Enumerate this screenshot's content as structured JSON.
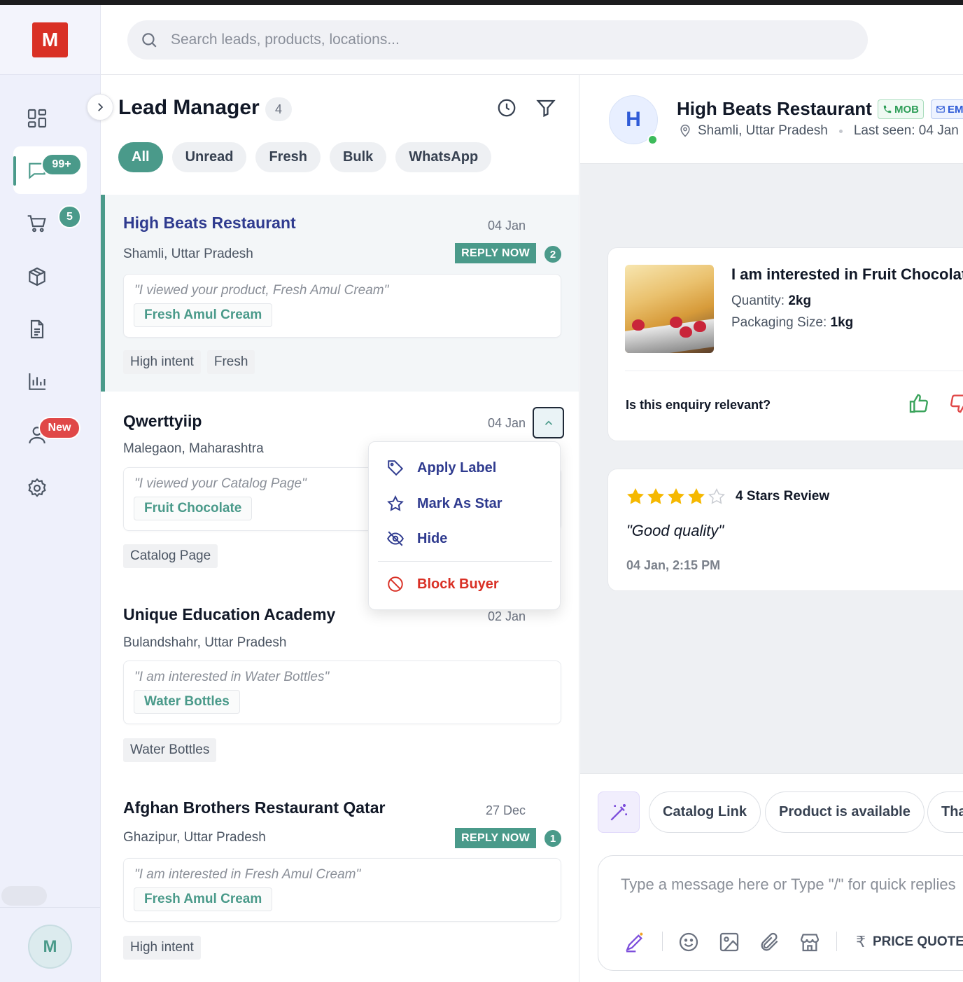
{
  "rail": {
    "logo": "M",
    "messages_badge": "99+",
    "cart_badge": "5",
    "contacts_badge": "New",
    "user_initial": "M"
  },
  "search": {
    "placeholder": "Search leads, products, locations..."
  },
  "leads_panel": {
    "title": "Lead Manager",
    "count": "4",
    "filters": [
      "All",
      "Unread",
      "Fresh",
      "Bulk",
      "WhatsApp"
    ],
    "active_filter": "All",
    "leads": [
      {
        "name": "High Beats Restaurant",
        "date": "04 Jan",
        "location": "Shamli, Uttar Pradesh",
        "reply_label": "REPLY NOW",
        "unread": "2",
        "quote": "\"I viewed your product, Fresh Amul Cream\"",
        "product": "Fresh Amul Cream",
        "labels": [
          "High intent",
          "Fresh"
        ]
      },
      {
        "name": "Qwerttyiip",
        "date": "04 Jan",
        "location": "Malegaon, Maharashtra",
        "quote": "\"I viewed your Catalog Page\"",
        "product": "Fruit Chocolate",
        "labels": [
          "Catalog Page"
        ]
      },
      {
        "name": "Unique Education Academy",
        "date": "02 Jan",
        "location": "Bulandshahr, Uttar Pradesh",
        "quote": "\"I am interested in Water Bottles\"",
        "product": "Water Bottles",
        "labels": [
          "Water Bottles"
        ]
      },
      {
        "name": "Afghan Brothers Restaurant Qatar",
        "date": "27 Dec",
        "location": "Ghazipur, Uttar Pradesh",
        "reply_label": "REPLY NOW",
        "unread": "1",
        "quote": "\"I am interested in Fresh Amul Cream\"",
        "product": "Fresh Amul Cream",
        "labels": [
          "High intent"
        ]
      }
    ]
  },
  "menu": {
    "items": [
      "Apply Label",
      "Mark As Star",
      "Hide",
      "Block Buyer"
    ]
  },
  "chat": {
    "avatar_initial": "H",
    "name": "High Beats Restaurant",
    "tag_mob": "MOB",
    "tag_email": "EM",
    "location": "Shamli, Uttar Pradesh",
    "last_seen": "Last seen: 04 Jan",
    "enquiry": {
      "title": "I am interested in Fruit Chocolate",
      "quantity_label": "Quantity:",
      "quantity": "2kg",
      "packaging_label": "Packaging Size:",
      "packaging": "1kg",
      "relevance_question": "Is this enquiry relevant?"
    },
    "review": {
      "rating": 4,
      "max_rating": 5,
      "label": "4 Stars Review",
      "text": "\"Good quality\"",
      "date": "04 Jan, 2:15 PM"
    },
    "quick_replies": [
      "Catalog Link",
      "Product is available",
      "Thank you"
    ],
    "message_placeholder": "Type a message here or Type \"/\" for quick replies",
    "price_quote": "PRICE QUOTE",
    "rupee": "₹"
  },
  "colors": {
    "accent": "#4a9a8a",
    "brand": "#d93025",
    "link": "#2f3b8f",
    "danger": "#d93025",
    "star": "#f5b800"
  }
}
